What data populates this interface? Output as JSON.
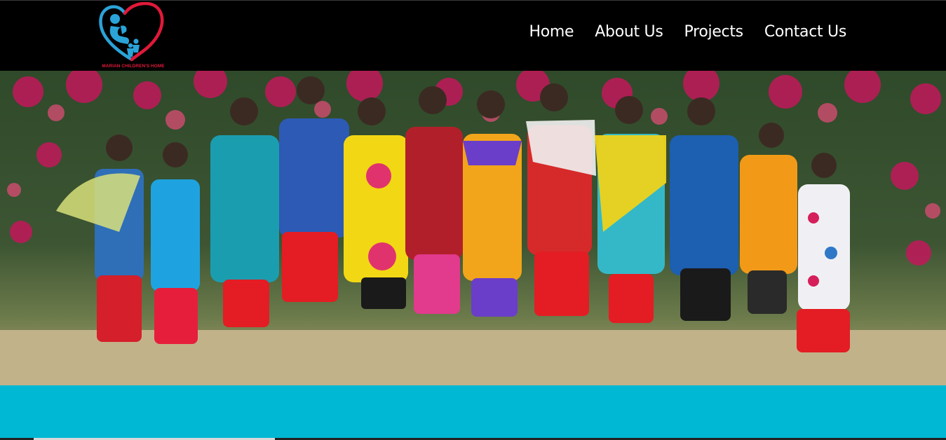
{
  "brand": {
    "logo_text": "MARIAN CHILDREN'S HOME",
    "logo_icon": "heart-mother-children-icon",
    "heart_color": "#e0193a",
    "figure_color": "#2aa3d8"
  },
  "nav": {
    "items": [
      {
        "label": "Home"
      },
      {
        "label": "About Us"
      },
      {
        "label": "Projects"
      },
      {
        "label": "Contact Us"
      }
    ]
  },
  "hero": {
    "image_alt": "hero-photo"
  },
  "colors": {
    "header_bg": "#000000",
    "band_bg": "#00b8d4"
  }
}
